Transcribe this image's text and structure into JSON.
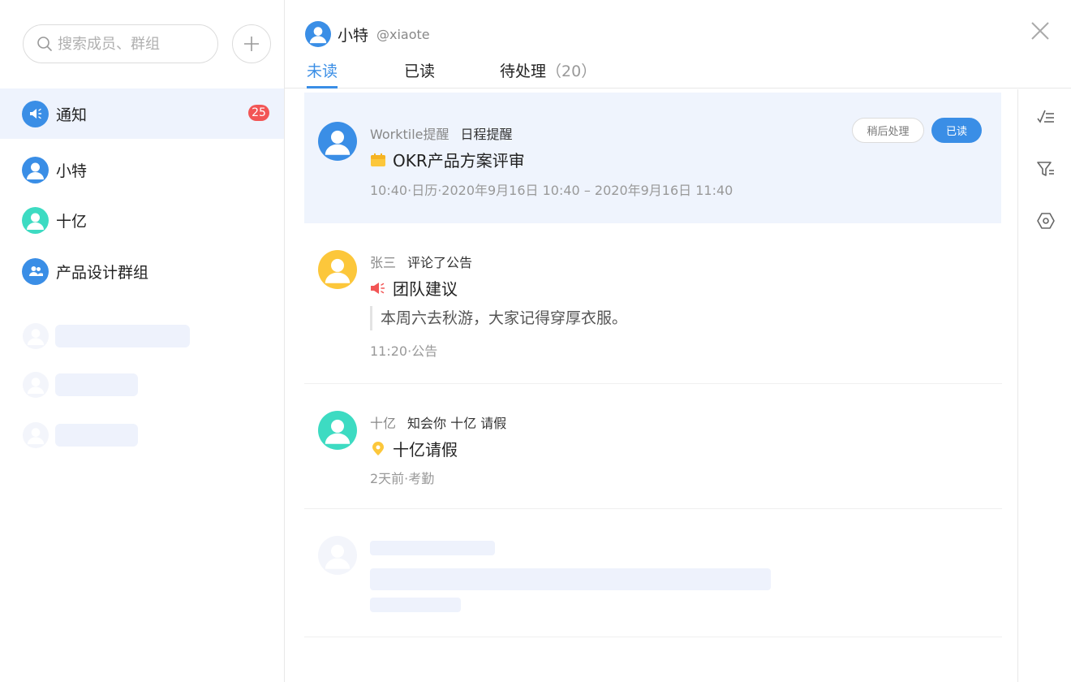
{
  "search": {
    "placeholder": "搜索成员、群组"
  },
  "sidebar": {
    "items": [
      {
        "label": "通知",
        "badge": "25"
      },
      {
        "label": "小特"
      },
      {
        "label": "十亿"
      },
      {
        "label": "产品设计群组"
      }
    ]
  },
  "header": {
    "user_name": "小特",
    "user_handle": "@xiaote",
    "tabs": [
      {
        "label": "未读"
      },
      {
        "label": "已读"
      },
      {
        "label": "待处理",
        "count": "（20）"
      }
    ]
  },
  "notifications": [
    {
      "source": "Worktile提醒",
      "action": "日程提醒",
      "title": "OKR产品方案评审",
      "sub": "10:40·日历·2020年9月16日 10:40 – 2020年9月16日 11:40",
      "later_label": "稍后处理",
      "read_label": "已读"
    },
    {
      "source": "张三",
      "action": "评论了公告",
      "title": "团队建议",
      "quote": "本周六去秋游，大家记得穿厚衣服。",
      "sub": "11:20·公告"
    },
    {
      "source": "十亿",
      "action": "知会你 十亿 请假",
      "title": "十亿请假",
      "sub": "2天前·考勤"
    }
  ],
  "colors": {
    "accent": "#3a8ee6",
    "badge": "#f25555",
    "avatar_blue": "#3a8ee6",
    "avatar_teal": "#3ddbc2",
    "avatar_yellow": "#fcc73b"
  },
  "icons": {
    "search": "search-icon",
    "add": "plus-icon",
    "close": "close-icon",
    "rail": [
      "mark-all-read-icon",
      "filter-icon",
      "settings-icon"
    ]
  }
}
